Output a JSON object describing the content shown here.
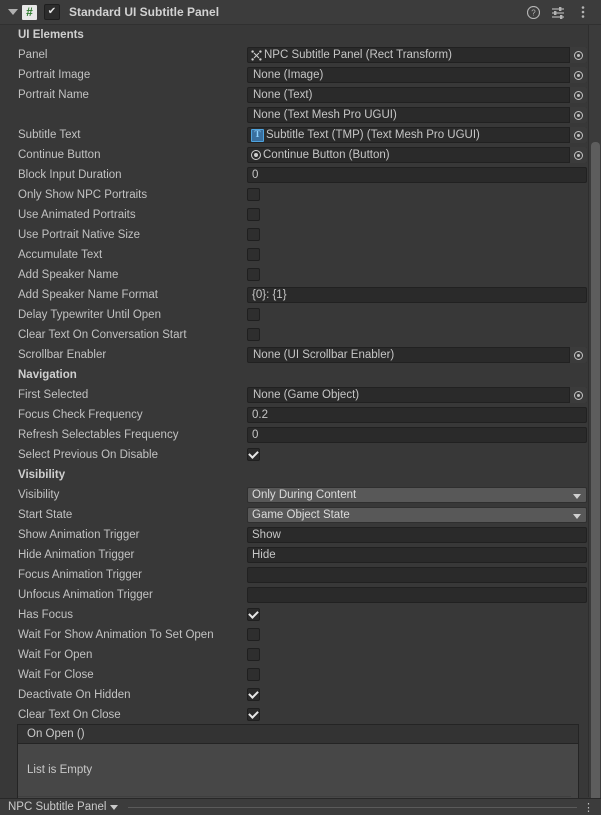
{
  "header": {
    "title": "Standard UI Subtitle Panel",
    "foldout_icon": "triangle-down-icon",
    "script_icon": "script-hash-icon",
    "enabled": true,
    "enabled_mark": "✔",
    "help_icon": "help-icon",
    "preset_icon": "preset-icon",
    "menu_icon": "kebab-menu-icon"
  },
  "sections": [
    {
      "name": "ui-elements",
      "title": "UI Elements",
      "rows": [
        {
          "name": "panel",
          "label": "Panel",
          "type": "object",
          "value": "NPC Subtitle Panel (Rect Transform)",
          "icon": "rect-transform-icon"
        },
        {
          "name": "portrait-image",
          "label": "Portrait Image",
          "type": "object",
          "value": "None (Image)",
          "icon": "none-icon"
        },
        {
          "name": "portrait-name",
          "label": "Portrait Name",
          "type": "object",
          "value": "None (Text)",
          "icon": "none-icon"
        },
        {
          "name": "portrait-name-tmp",
          "label": "",
          "type": "object",
          "value": "None (Text Mesh Pro UGUI)",
          "icon": "none-icon"
        },
        {
          "name": "subtitle-text",
          "label": "Subtitle Text",
          "type": "object",
          "value": "Subtitle Text (TMP) (Text Mesh Pro UGUI)",
          "icon": "tmp-icon"
        },
        {
          "name": "continue-button",
          "label": "Continue Button",
          "type": "object",
          "value": "Continue Button (Button)",
          "icon": "button-icon"
        },
        {
          "name": "block-input-duration",
          "label": "Block Input Duration",
          "type": "text",
          "value": "0"
        },
        {
          "name": "only-show-npc-portraits",
          "label": "Only Show NPC Portraits",
          "type": "checkbox",
          "value": false
        },
        {
          "name": "use-animated-portraits",
          "label": "Use Animated Portraits",
          "type": "checkbox",
          "value": false
        },
        {
          "name": "use-portrait-native-size",
          "label": "Use Portrait Native Size",
          "type": "checkbox",
          "value": false
        },
        {
          "name": "accumulate-text",
          "label": "Accumulate Text",
          "type": "checkbox",
          "value": false
        },
        {
          "name": "add-speaker-name",
          "label": "Add Speaker Name",
          "type": "checkbox",
          "value": false
        },
        {
          "name": "add-speaker-name-format",
          "label": "Add Speaker Name Format",
          "type": "text",
          "value": "{0}: {1}"
        },
        {
          "name": "delay-typewriter-until-open",
          "label": "Delay Typewriter Until Open",
          "type": "checkbox",
          "value": false
        },
        {
          "name": "clear-text-on-conversation-start",
          "label": "Clear Text On Conversation Start",
          "type": "checkbox",
          "value": false
        },
        {
          "name": "scrollbar-enabler",
          "label": "Scrollbar Enabler",
          "type": "object",
          "value": "None (UI Scrollbar Enabler)",
          "icon": "none-icon"
        }
      ]
    },
    {
      "name": "navigation",
      "title": "Navigation",
      "rows": [
        {
          "name": "first-selected",
          "label": "First Selected",
          "type": "object",
          "value": "None (Game Object)",
          "icon": "none-icon"
        },
        {
          "name": "focus-check-frequency",
          "label": "Focus Check Frequency",
          "type": "text",
          "value": "0.2"
        },
        {
          "name": "refresh-selectables-frequency",
          "label": "Refresh Selectables Frequency",
          "type": "text",
          "value": "0"
        },
        {
          "name": "select-previous-on-disable",
          "label": "Select Previous On Disable",
          "type": "checkbox",
          "value": true
        }
      ]
    },
    {
      "name": "visibility",
      "title": "Visibility",
      "rows": [
        {
          "name": "visibility",
          "label": "Visibility",
          "type": "dropdown",
          "value": "Only During Content"
        },
        {
          "name": "start-state",
          "label": "Start State",
          "type": "dropdown",
          "value": "Game Object State"
        },
        {
          "name": "show-animation-trigger",
          "label": "Show Animation Trigger",
          "type": "text",
          "value": "Show"
        },
        {
          "name": "hide-animation-trigger",
          "label": "Hide Animation Trigger",
          "type": "text",
          "value": "Hide"
        },
        {
          "name": "focus-animation-trigger",
          "label": "Focus Animation Trigger",
          "type": "text",
          "value": ""
        },
        {
          "name": "unfocus-animation-trigger",
          "label": "Unfocus Animation Trigger",
          "type": "text",
          "value": ""
        },
        {
          "name": "has-focus",
          "label": "Has Focus",
          "type": "checkbox",
          "value": true
        },
        {
          "name": "wait-for-show-animation-to-set-open",
          "label": "Wait For Show Animation To Set Open",
          "type": "checkbox",
          "value": false
        },
        {
          "name": "wait-for-open",
          "label": "Wait For Open",
          "type": "checkbox",
          "value": false
        },
        {
          "name": "wait-for-close",
          "label": "Wait For Close",
          "type": "checkbox",
          "value": false
        },
        {
          "name": "deactivate-on-hidden",
          "label": "Deactivate On Hidden",
          "type": "checkbox",
          "value": true
        },
        {
          "name": "clear-text-on-close",
          "label": "Clear Text On Close",
          "type": "checkbox",
          "value": true
        }
      ]
    }
  ],
  "event_box": {
    "title": "On Open ()",
    "empty_text": "List is Empty"
  },
  "bottom_bar": {
    "breadcrumb": "NPC Subtitle Panel",
    "caret_icon": "triangle-down-icon",
    "menu_icon": "kebab-menu-icon"
  },
  "colors": {
    "background": "#383838",
    "header": "#3c3c3c",
    "field": "#2a2a2a",
    "dropdown": "#585858",
    "accent_tmp": "#4ea4e0"
  }
}
